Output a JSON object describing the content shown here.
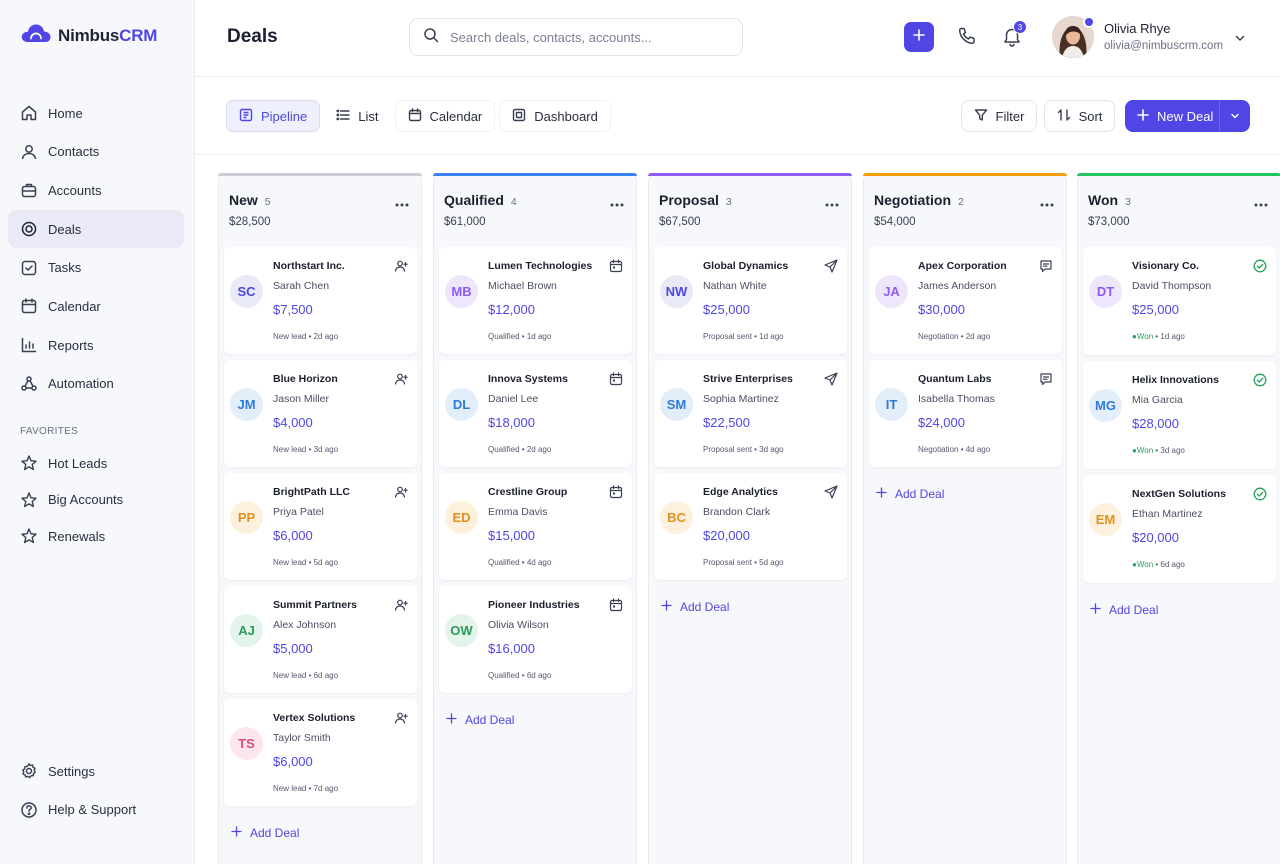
{
  "brand": {
    "name_part1": "Nimbus",
    "name_part2": "CRM"
  },
  "nav": {
    "items": [
      {
        "label": "Home"
      },
      {
        "label": "Contacts"
      },
      {
        "label": "Accounts"
      },
      {
        "label": "Deals"
      },
      {
        "label": "Tasks"
      },
      {
        "label": "Calendar"
      },
      {
        "label": "Reports"
      },
      {
        "label": "Automation"
      }
    ],
    "favorites_title": "FAVORITES",
    "favorites": [
      {
        "label": "Hot Leads"
      },
      {
        "label": "Big Accounts"
      },
      {
        "label": "Renewals"
      }
    ],
    "bottom": [
      {
        "label": "Settings"
      },
      {
        "label": "Help & Support"
      }
    ]
  },
  "header": {
    "title": "Deals",
    "search_placeholder": "Search deals, contacts, accounts...",
    "notification_count": "3",
    "user_name": "Olivia Rhye",
    "user_email": "olivia@nimbuscrm.com"
  },
  "toolbar": {
    "tabs": [
      {
        "label": "Pipeline"
      },
      {
        "label": "List"
      },
      {
        "label": "Calendar"
      },
      {
        "label": "Dashboard"
      }
    ],
    "filter_label": "Filter",
    "sort_label": "Sort",
    "new_deal_label": "New Deal"
  },
  "add_deal_label": "Add Deal",
  "colors": {
    "accent": "#4f46e5",
    "new": "#c9ccd8",
    "qualified": "#3b82f6",
    "proposal": "#8b5cf6",
    "negotiation": "#f59e0b",
    "won": "#22c55e"
  },
  "columns": [
    {
      "title": "New",
      "count": "5",
      "total": "$28,500",
      "cards": [
        {
          "initials": "SC",
          "company": "Northstart Inc.",
          "contact": "Sarah Chen",
          "amount": "$7,500",
          "meta": "New lead • 2d ago"
        },
        {
          "initials": "JM",
          "company": "Blue Horizon",
          "contact": "Jason Miller",
          "amount": "$4,000",
          "meta": "New lead • 3d ago"
        },
        {
          "initials": "PP",
          "company": "BrightPath LLC",
          "contact": "Priya Patel",
          "amount": "$6,000",
          "meta": "New lead • 5d ago"
        },
        {
          "initials": "AJ",
          "company": "Summit Partners",
          "contact": "Alex Johnson",
          "amount": "$5,000",
          "meta": "New lead • 6d ago"
        },
        {
          "initials": "TS",
          "company": "Vertex Solutions",
          "contact": "Taylor Smith",
          "amount": "$6,000",
          "meta": "New lead • 7d ago"
        }
      ]
    },
    {
      "title": "Qualified",
      "count": "4",
      "total": "$61,000",
      "cards": [
        {
          "initials": "MB",
          "company": "Lumen Technologies",
          "contact": "Michael Brown",
          "amount": "$12,000",
          "meta": "Qualified • 1d ago"
        },
        {
          "initials": "DL",
          "company": "Innova Systems",
          "contact": "Daniel Lee",
          "amount": "$18,000",
          "meta": "Qualified • 2d ago"
        },
        {
          "initials": "ED",
          "company": "Crestline Group",
          "contact": "Emma Davis",
          "amount": "$15,000",
          "meta": "Qualified • 4d ago"
        },
        {
          "initials": "OW",
          "company": "Pioneer Industries",
          "contact": "Olivia Wilson",
          "amount": "$16,000",
          "meta": "Qualified • 6d ago"
        }
      ]
    },
    {
      "title": "Proposal",
      "count": "3",
      "total": "$67,500",
      "cards": [
        {
          "initials": "NW",
          "company": "Global Dynamics",
          "contact": "Nathan White",
          "amount": "$25,000",
          "meta": "Proposal sent • 1d ago"
        },
        {
          "initials": "SM",
          "company": "Strive Enterprises",
          "contact": "Sophia Martinez",
          "amount": "$22,500",
          "meta": "Proposal sent • 3d ago"
        },
        {
          "initials": "BC",
          "company": "Edge Analytics",
          "contact": "Brandon Clark",
          "amount": "$20,000",
          "meta": "Proposal sent • 5d ago"
        }
      ]
    },
    {
      "title": "Negotiation",
      "count": "2",
      "total": "$54,000",
      "cards": [
        {
          "initials": "JA",
          "company": "Apex Corporation",
          "contact": "James Anderson",
          "amount": "$30,000",
          "meta": "Negotiation • 2d ago"
        },
        {
          "initials": "IT",
          "company": "Quantum Labs",
          "contact": "Isabella Thomas",
          "amount": "$24,000",
          "meta": "Negotiation • 4d ago"
        }
      ]
    },
    {
      "title": "Won",
      "count": "3",
      "total": "$73,000",
      "cards": [
        {
          "initials": "DT",
          "company": "Visionary Co.",
          "contact": "David Thompson",
          "amount": "$25,000",
          "meta_status": "Won",
          "meta_time": " • 1d ago"
        },
        {
          "initials": "MG",
          "company": "Helix Innovations",
          "contact": "Mia Garcia",
          "amount": "$28,000",
          "meta_status": "Won",
          "meta_time": " • 3d ago"
        },
        {
          "initials": "EM",
          "company": "NextGen Solutions",
          "contact": "Ethan Martinez",
          "amount": "$20,000",
          "meta_status": "Won",
          "meta_time": " • 6d ago"
        }
      ]
    }
  ]
}
